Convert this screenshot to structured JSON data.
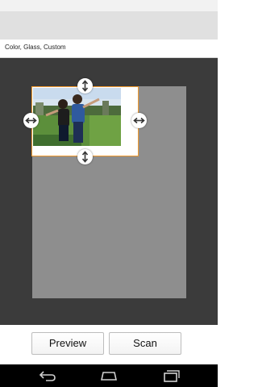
{
  "settings": {
    "summary": "Color, Glass, Custom"
  },
  "buttons": {
    "preview_label": "Preview",
    "scan_label": "Scan"
  },
  "colors": {
    "crop_border": "#f29a2e",
    "workspace_bg": "#3b3b3b",
    "scan_bed": "#8e8e8e",
    "action_bar": "#e0e0e0",
    "nav_bar": "#000000"
  },
  "icons": {
    "handles": [
      "vertical-resize-icon",
      "horizontal-resize-icon"
    ],
    "nav": [
      "back-icon",
      "home-icon",
      "recents-icon"
    ]
  }
}
